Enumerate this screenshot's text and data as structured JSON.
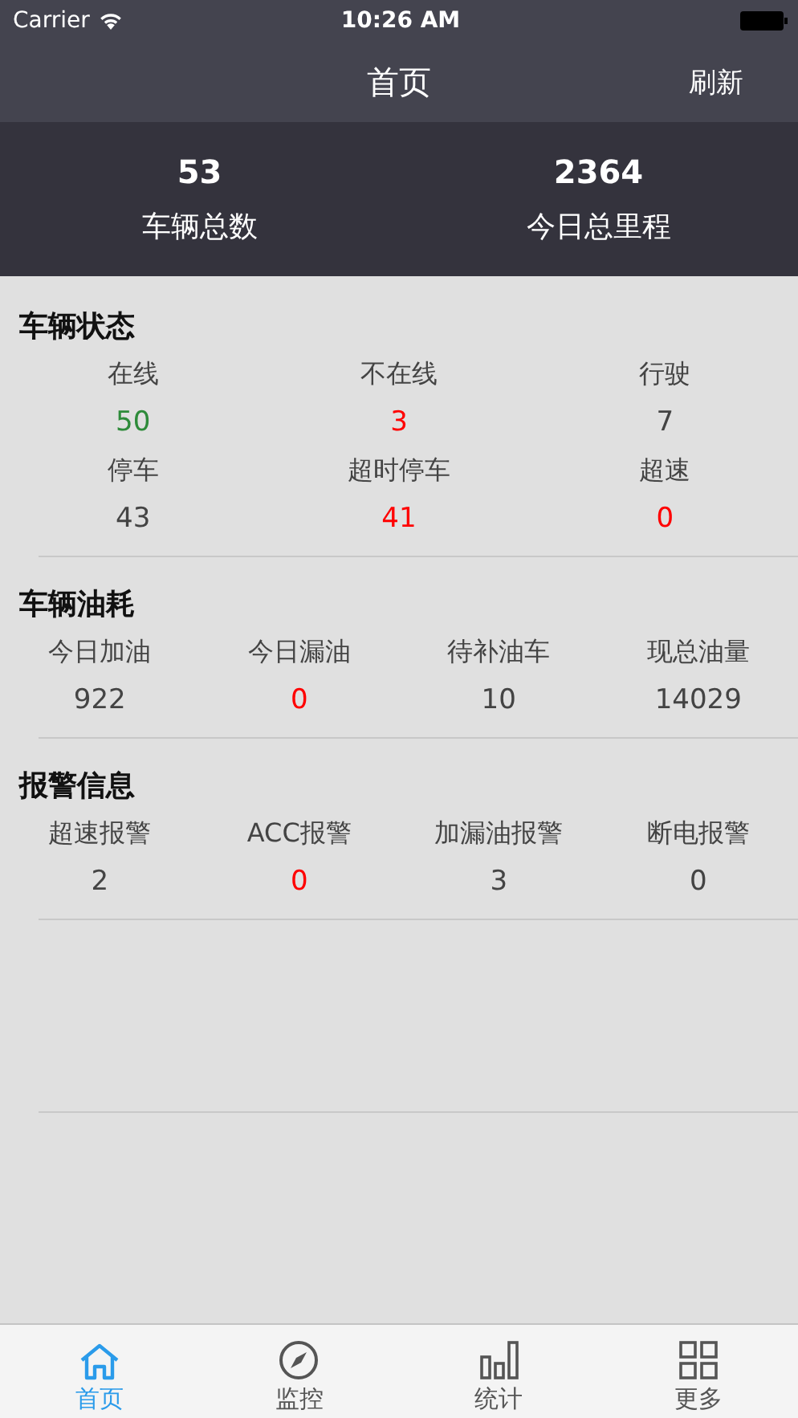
{
  "status_bar": {
    "carrier": "Carrier",
    "time": "10:26 AM"
  },
  "nav_bar": {
    "title": "首页",
    "action": "刷新"
  },
  "summary": [
    {
      "value": "53",
      "label": "车辆总数"
    },
    {
      "value": "2364",
      "label": "今日总里程"
    }
  ],
  "sections": [
    {
      "title": "车辆状态",
      "items": [
        {
          "label": "在线",
          "value": "50",
          "color": "#2e8b3a"
        },
        {
          "label": "不在线",
          "value": "3",
          "color": "#ff0000"
        },
        {
          "label": "行驶",
          "value": "7",
          "color": "#444444"
        },
        {
          "label": "停车",
          "value": "43",
          "color": "#444444"
        },
        {
          "label": "超时停车",
          "value": "41",
          "color": "#ff0000"
        },
        {
          "label": "超速",
          "value": "0",
          "color": "#ff0000"
        }
      ]
    },
    {
      "title": "车辆油耗",
      "items": [
        {
          "label": "今日加油",
          "value": "922",
          "color": "#444444"
        },
        {
          "label": "今日漏油",
          "value": "0",
          "color": "#ff0000"
        },
        {
          "label": "待补油车",
          "value": "10",
          "color": "#444444"
        },
        {
          "label": "现总油量",
          "value": "14029",
          "color": "#444444"
        }
      ]
    },
    {
      "title": "报警信息",
      "items": [
        {
          "label": "超速报警",
          "value": "2",
          "color": "#444444"
        },
        {
          "label": "ACC报警",
          "value": "0",
          "color": "#ff0000"
        },
        {
          "label": "加漏油报警",
          "value": "3",
          "color": "#444444"
        },
        {
          "label": "断电报警",
          "value": "0",
          "color": "#444444"
        }
      ]
    }
  ],
  "tab_bar": [
    {
      "label": "首页",
      "selected": true
    },
    {
      "label": "监控",
      "selected": false
    },
    {
      "label": "统计",
      "selected": false
    },
    {
      "label": "更多",
      "selected": false
    }
  ]
}
